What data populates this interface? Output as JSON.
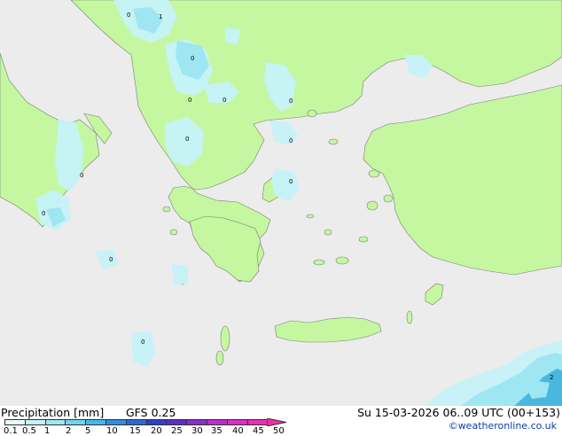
{
  "map": {
    "colors": {
      "sea": "#ececec",
      "land": "#c5f7a0",
      "precip_light": "#c6f2f8",
      "precip_mid": "#9ee6f2",
      "precip_heavy": "#4ab7df",
      "coast": "#7a7a7a"
    },
    "point_values": [
      "0",
      "1",
      "0",
      "0",
      "0",
      "0",
      "0",
      "0",
      "0",
      "0",
      "0",
      "0",
      "0",
      "2"
    ]
  },
  "footer": {
    "legend_title": "Precipitation [mm]",
    "model": "GFS 0.25",
    "valid_time": "Su 15-03-2026 06..09 UTC (00+153)",
    "credit": "©weatheronline.co.uk"
  },
  "scale": {
    "labels": [
      "0.1",
      "0.5",
      "1",
      "2",
      "5",
      "10",
      "15",
      "20",
      "25",
      "30",
      "35",
      "40",
      "45",
      "50"
    ],
    "colors": [
      "#e8fafc",
      "#c6f2f8",
      "#9ee6f2",
      "#6fd4ee",
      "#46b8e8",
      "#2f8fe0",
      "#2f66d8",
      "#2f40c8",
      "#5a2fc8",
      "#8a2fc8",
      "#b82fc8",
      "#d82fc8",
      "#e82fb8",
      "#f02fa0"
    ]
  }
}
